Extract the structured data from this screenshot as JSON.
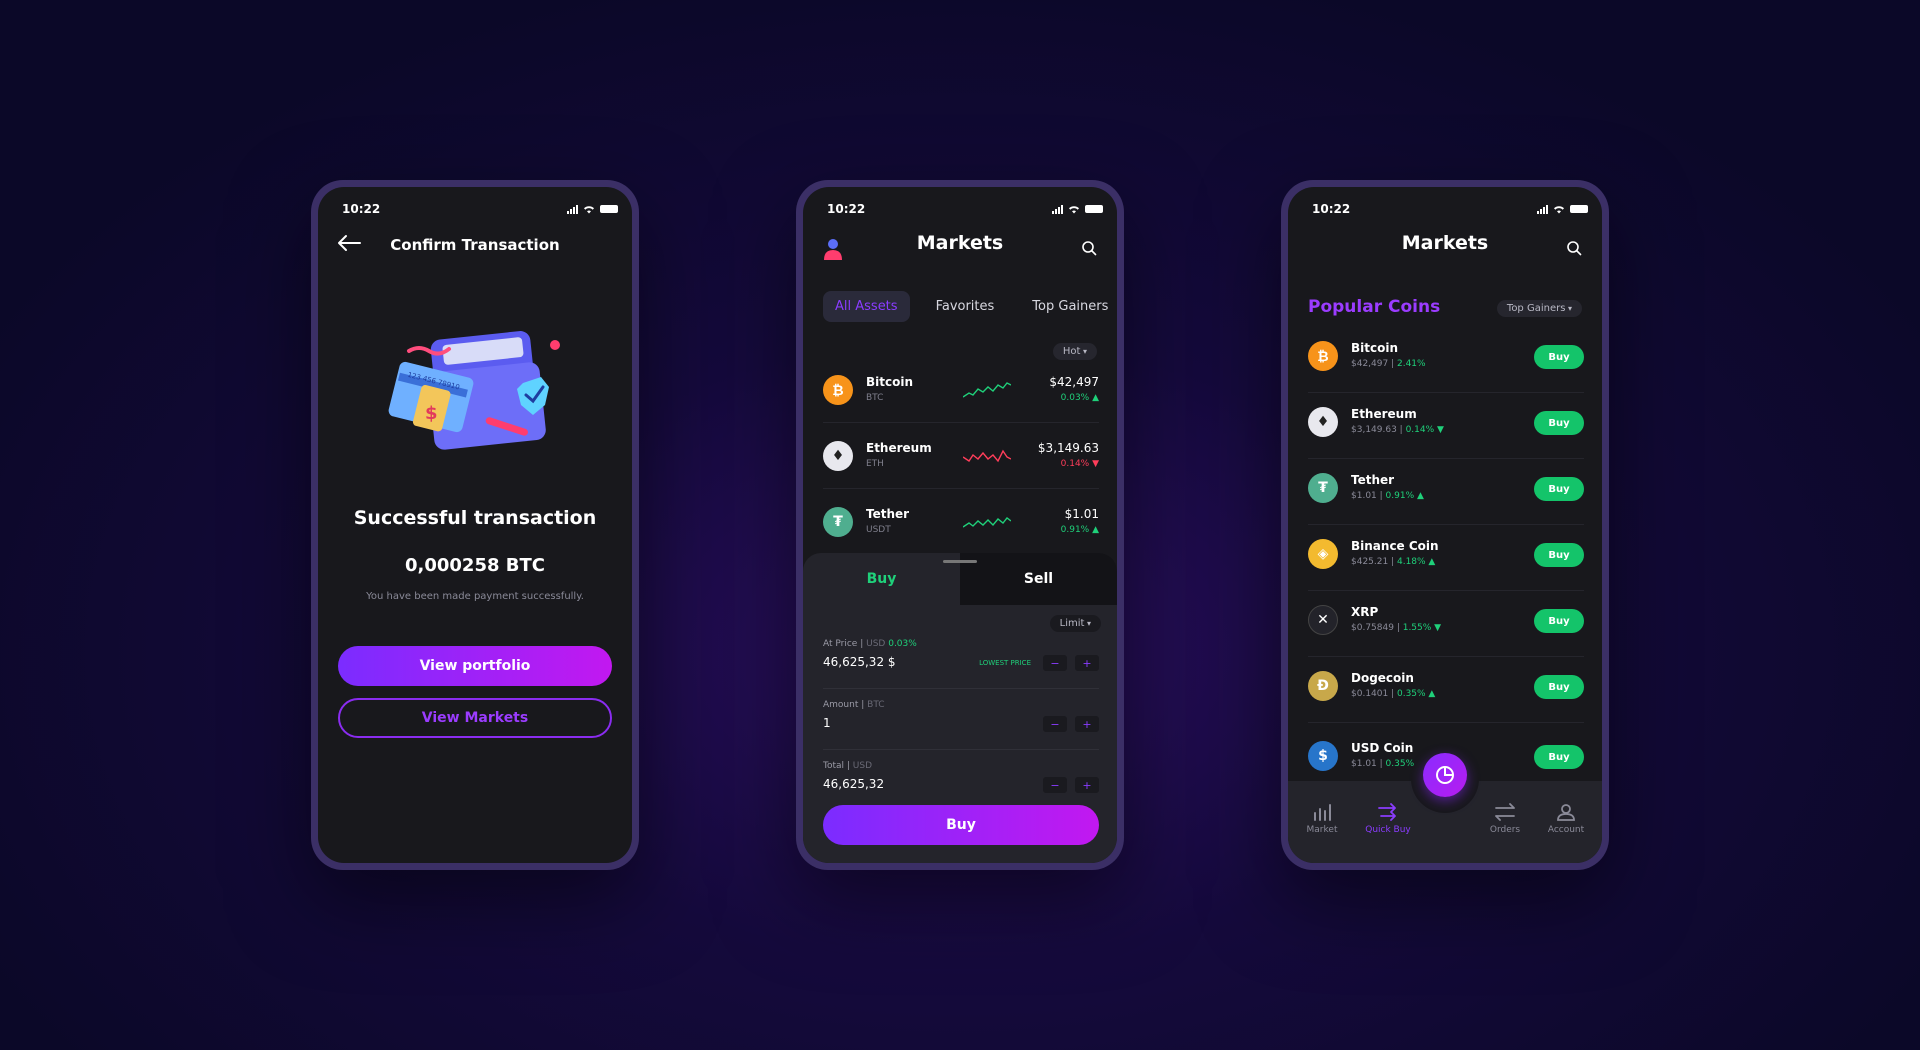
{
  "status_time": "10:22",
  "colors": {
    "accent": "#8a3cff",
    "up": "#1fd07a",
    "down": "#ff3d5a",
    "buy": "#14c46a"
  },
  "confirm": {
    "title": "Confirm Transaction",
    "heading": "Successful transaction",
    "amount": "0,000258 BTC",
    "message": "You have been made payment successfully.",
    "primary_button": "View portfolio",
    "secondary_button": "View Markets"
  },
  "markets": {
    "title": "Markets",
    "tabs": [
      "All Assets",
      "Favorites",
      "Top Gainers"
    ],
    "sort": "Hot",
    "coins": [
      {
        "name": "Bitcoin",
        "symbol": "BTC",
        "price": "$42,497",
        "change": "0.03% ▲",
        "trend": "up",
        "icon": "bitcoin-icon"
      },
      {
        "name": "Ethereum",
        "symbol": "ETH",
        "price": "$3,149.63",
        "change": "0.14% ▼",
        "trend": "down",
        "icon": "ethereum-icon"
      },
      {
        "name": "Tether",
        "symbol": "USDT",
        "price": "$1.01",
        "change": "0.91% ▲",
        "trend": "up",
        "icon": "tether-icon"
      }
    ],
    "trade": {
      "buy_tab": "Buy",
      "sell_tab": "Sell",
      "order_type": "Limit",
      "at_price_label": "At Price",
      "at_price_unit": "USD",
      "at_price_change": "0.03%",
      "at_price_value": "46,625,32 $",
      "lowest_price": "LOWEST PRICE",
      "amount_label": "Amount",
      "amount_unit": "BTC",
      "amount_value": "1",
      "total_label": "Total",
      "total_unit": "USD",
      "total_value": "46,625,32",
      "submit": "Buy"
    }
  },
  "popular": {
    "title": "Markets",
    "section": "Popular Coins",
    "filter": "Top Gainers",
    "buy_label": "Buy",
    "coins": [
      {
        "name": "Bitcoin",
        "price": "$42,497",
        "change": "2.41%"
      },
      {
        "name": "Ethereum",
        "price": "$3,149.63",
        "change": "0.14% ▼"
      },
      {
        "name": "Tether",
        "price": "$1.01",
        "change": "0.91% ▲"
      },
      {
        "name": "Binance Coin",
        "price": "$425.21",
        "change": "4.18% ▲"
      },
      {
        "name": "XRP",
        "price": "$0.75849",
        "change": "1.55% ▼"
      },
      {
        "name": "Dogecoin",
        "price": "$0.1401",
        "change": "0.35% ▲"
      },
      {
        "name": "USD Coin",
        "price": "$1.01",
        "change": "0.35% ▲"
      }
    ],
    "nav": [
      "Market",
      "Quick Buy",
      "Orders",
      "Account"
    ]
  }
}
